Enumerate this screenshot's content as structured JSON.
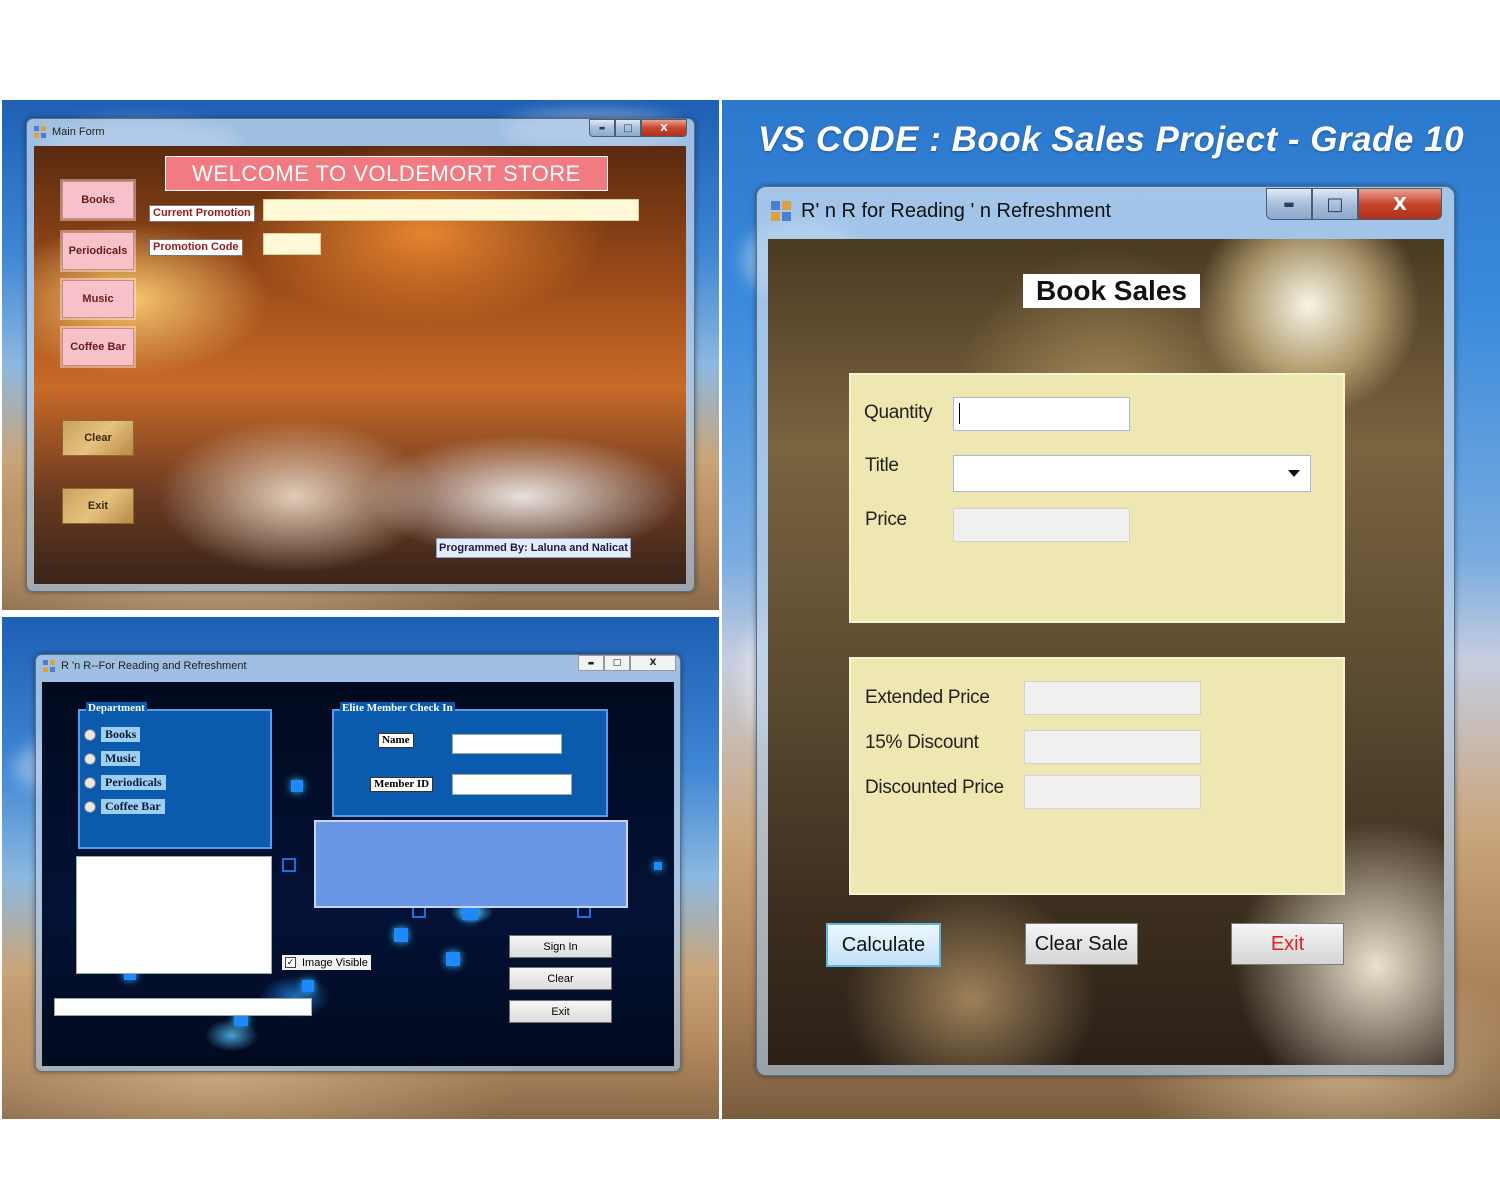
{
  "main_form": {
    "title": "Main Form",
    "welcome": "WELCOME TO VOLDEMORT STORE",
    "nav_buttons": [
      "Books",
      "Periodicals",
      "Music",
      "Coffee Bar"
    ],
    "clear_label": "Clear",
    "exit_label": "Exit",
    "current_promotion_label": "Current Promotion",
    "current_promotion_value": "",
    "promotion_code_label": "Promotion Code",
    "promotion_code_value": "",
    "credit": "Programmed By: Laluna and Nalicat"
  },
  "rnr_form": {
    "title": "R 'n R--For Reading and Refreshment",
    "department": {
      "caption": "Department",
      "options": [
        "Books",
        "Music",
        "Periodicals",
        "Coffee Bar"
      ]
    },
    "check_in": {
      "caption": "Elite Member Check In",
      "name_label": "Name",
      "name_value": "",
      "member_id_label": "Member ID",
      "member_id_value": ""
    },
    "image_visible_label": "Image  Visible",
    "image_visible_checked": true,
    "sign_in_label": "Sign In",
    "clear_label": "Clear",
    "exit_label": "Exit"
  },
  "heading": "VS CODE : Book Sales Project - Grade 10",
  "book_sales_form": {
    "title": "R' n R for Reading ' n Refreshment",
    "header": "Book Sales",
    "quantity_label": "Quantity",
    "quantity_value": "",
    "title_label": "Title",
    "title_value": "",
    "price_label": "Price",
    "price_value": "",
    "extended_price_label": "Extended Price",
    "extended_price_value": "",
    "discount_label": "15% Discount",
    "discount_value": "",
    "discounted_price_label": "Discounted Price",
    "discounted_price_value": "",
    "calculate_label": "Calculate",
    "clear_sale_label": "Clear Sale",
    "exit_label": "Exit",
    "exit_color": "#e02020"
  },
  "window_controls": {
    "minimize": "▬",
    "maximize": "□",
    "close": "X"
  }
}
